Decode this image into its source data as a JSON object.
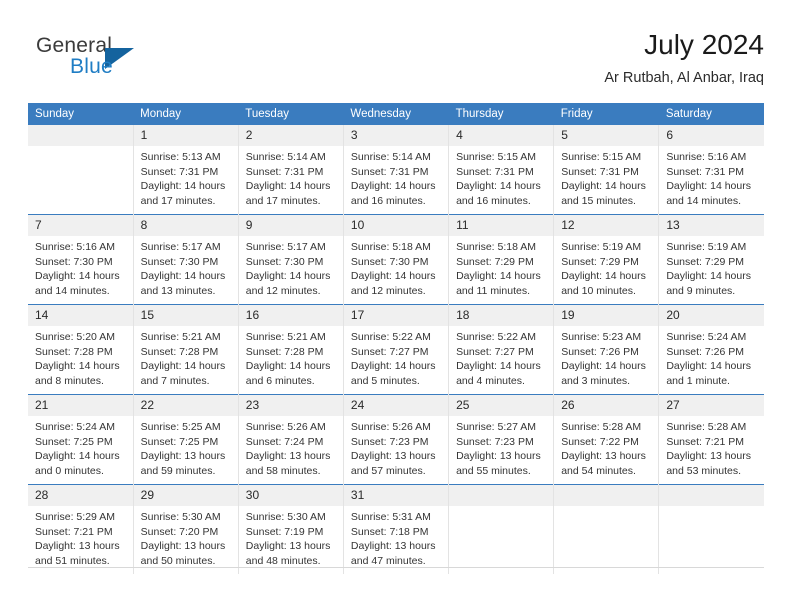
{
  "brand": {
    "name_top": "General",
    "name_bottom": "Blue",
    "triangle_icon": "blue-triangle-icon",
    "color_dark": "#3b3b3b",
    "color_blue": "#1f7dc4",
    "color_triangle": "#14639e"
  },
  "header": {
    "title": "July 2024",
    "subtitle": "Ar Rutbah, Al Anbar, Iraq"
  },
  "theme": {
    "header_blue": "#3a7cbf",
    "daynum_gray": "#f0f0f0",
    "text": "#343434"
  },
  "calendar": {
    "weekday_headers": [
      "Sunday",
      "Monday",
      "Tuesday",
      "Wednesday",
      "Thursday",
      "Friday",
      "Saturday"
    ],
    "weeks": [
      [
        {
          "day": "",
          "lines": []
        },
        {
          "day": "1",
          "lines": [
            "Sunrise: 5:13 AM",
            "Sunset: 7:31 PM",
            "Daylight: 14 hours",
            "and 17 minutes."
          ]
        },
        {
          "day": "2",
          "lines": [
            "Sunrise: 5:14 AM",
            "Sunset: 7:31 PM",
            "Daylight: 14 hours",
            "and 17 minutes."
          ]
        },
        {
          "day": "3",
          "lines": [
            "Sunrise: 5:14 AM",
            "Sunset: 7:31 PM",
            "Daylight: 14 hours",
            "and 16 minutes."
          ]
        },
        {
          "day": "4",
          "lines": [
            "Sunrise: 5:15 AM",
            "Sunset: 7:31 PM",
            "Daylight: 14 hours",
            "and 16 minutes."
          ]
        },
        {
          "day": "5",
          "lines": [
            "Sunrise: 5:15 AM",
            "Sunset: 7:31 PM",
            "Daylight: 14 hours",
            "and 15 minutes."
          ]
        },
        {
          "day": "6",
          "lines": [
            "Sunrise: 5:16 AM",
            "Sunset: 7:31 PM",
            "Daylight: 14 hours",
            "and 14 minutes."
          ]
        }
      ],
      [
        {
          "day": "7",
          "lines": [
            "Sunrise: 5:16 AM",
            "Sunset: 7:30 PM",
            "Daylight: 14 hours",
            "and 14 minutes."
          ]
        },
        {
          "day": "8",
          "lines": [
            "Sunrise: 5:17 AM",
            "Sunset: 7:30 PM",
            "Daylight: 14 hours",
            "and 13 minutes."
          ]
        },
        {
          "day": "9",
          "lines": [
            "Sunrise: 5:17 AM",
            "Sunset: 7:30 PM",
            "Daylight: 14 hours",
            "and 12 minutes."
          ]
        },
        {
          "day": "10",
          "lines": [
            "Sunrise: 5:18 AM",
            "Sunset: 7:30 PM",
            "Daylight: 14 hours",
            "and 12 minutes."
          ]
        },
        {
          "day": "11",
          "lines": [
            "Sunrise: 5:18 AM",
            "Sunset: 7:29 PM",
            "Daylight: 14 hours",
            "and 11 minutes."
          ]
        },
        {
          "day": "12",
          "lines": [
            "Sunrise: 5:19 AM",
            "Sunset: 7:29 PM",
            "Daylight: 14 hours",
            "and 10 minutes."
          ]
        },
        {
          "day": "13",
          "lines": [
            "Sunrise: 5:19 AM",
            "Sunset: 7:29 PM",
            "Daylight: 14 hours",
            "and 9 minutes."
          ]
        }
      ],
      [
        {
          "day": "14",
          "lines": [
            "Sunrise: 5:20 AM",
            "Sunset: 7:28 PM",
            "Daylight: 14 hours",
            "and 8 minutes."
          ]
        },
        {
          "day": "15",
          "lines": [
            "Sunrise: 5:21 AM",
            "Sunset: 7:28 PM",
            "Daylight: 14 hours",
            "and 7 minutes."
          ]
        },
        {
          "day": "16",
          "lines": [
            "Sunrise: 5:21 AM",
            "Sunset: 7:28 PM",
            "Daylight: 14 hours",
            "and 6 minutes."
          ]
        },
        {
          "day": "17",
          "lines": [
            "Sunrise: 5:22 AM",
            "Sunset: 7:27 PM",
            "Daylight: 14 hours",
            "and 5 minutes."
          ]
        },
        {
          "day": "18",
          "lines": [
            "Sunrise: 5:22 AM",
            "Sunset: 7:27 PM",
            "Daylight: 14 hours",
            "and 4 minutes."
          ]
        },
        {
          "day": "19",
          "lines": [
            "Sunrise: 5:23 AM",
            "Sunset: 7:26 PM",
            "Daylight: 14 hours",
            "and 3 minutes."
          ]
        },
        {
          "day": "20",
          "lines": [
            "Sunrise: 5:24 AM",
            "Sunset: 7:26 PM",
            "Daylight: 14 hours",
            "and 1 minute."
          ]
        }
      ],
      [
        {
          "day": "21",
          "lines": [
            "Sunrise: 5:24 AM",
            "Sunset: 7:25 PM",
            "Daylight: 14 hours",
            "and 0 minutes."
          ]
        },
        {
          "day": "22",
          "lines": [
            "Sunrise: 5:25 AM",
            "Sunset: 7:25 PM",
            "Daylight: 13 hours",
            "and 59 minutes."
          ]
        },
        {
          "day": "23",
          "lines": [
            "Sunrise: 5:26 AM",
            "Sunset: 7:24 PM",
            "Daylight: 13 hours",
            "and 58 minutes."
          ]
        },
        {
          "day": "24",
          "lines": [
            "Sunrise: 5:26 AM",
            "Sunset: 7:23 PM",
            "Daylight: 13 hours",
            "and 57 minutes."
          ]
        },
        {
          "day": "25",
          "lines": [
            "Sunrise: 5:27 AM",
            "Sunset: 7:23 PM",
            "Daylight: 13 hours",
            "and 55 minutes."
          ]
        },
        {
          "day": "26",
          "lines": [
            "Sunrise: 5:28 AM",
            "Sunset: 7:22 PM",
            "Daylight: 13 hours",
            "and 54 minutes."
          ]
        },
        {
          "day": "27",
          "lines": [
            "Sunrise: 5:28 AM",
            "Sunset: 7:21 PM",
            "Daylight: 13 hours",
            "and 53 minutes."
          ]
        }
      ],
      [
        {
          "day": "28",
          "lines": [
            "Sunrise: 5:29 AM",
            "Sunset: 7:21 PM",
            "Daylight: 13 hours",
            "and 51 minutes."
          ]
        },
        {
          "day": "29",
          "lines": [
            "Sunrise: 5:30 AM",
            "Sunset: 7:20 PM",
            "Daylight: 13 hours",
            "and 50 minutes."
          ]
        },
        {
          "day": "30",
          "lines": [
            "Sunrise: 5:30 AM",
            "Sunset: 7:19 PM",
            "Daylight: 13 hours",
            "and 48 minutes."
          ]
        },
        {
          "day": "31",
          "lines": [
            "Sunrise: 5:31 AM",
            "Sunset: 7:18 PM",
            "Daylight: 13 hours",
            "and 47 minutes."
          ]
        },
        {
          "day": "",
          "lines": []
        },
        {
          "day": "",
          "lines": []
        },
        {
          "day": "",
          "lines": []
        }
      ]
    ]
  }
}
